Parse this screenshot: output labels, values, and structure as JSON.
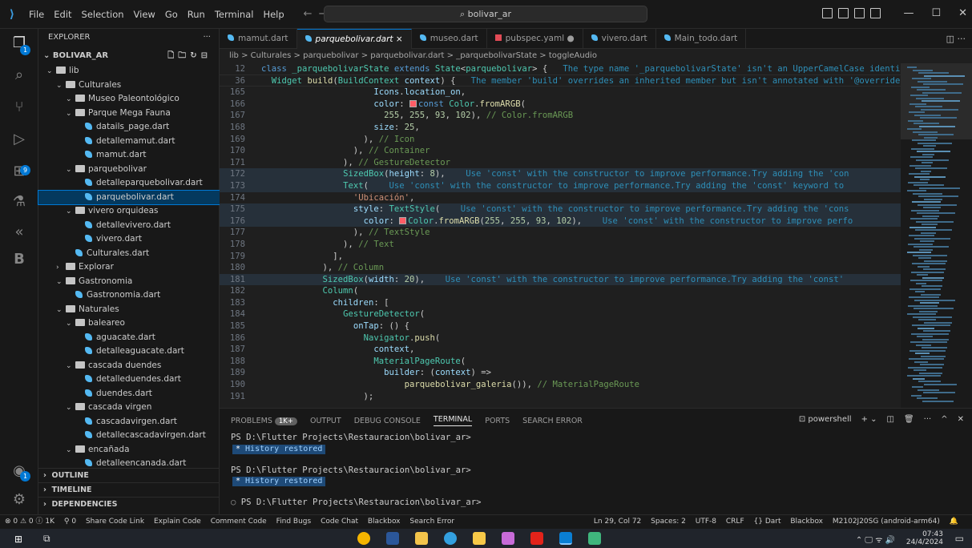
{
  "titlebar": {
    "menu": [
      "File",
      "Edit",
      "Selection",
      "View",
      "Go",
      "Run",
      "Terminal",
      "Help"
    ],
    "search": "bolivar_ar"
  },
  "sidebar": {
    "title": "EXPLORER",
    "root": "BOLIVAR_AR",
    "tree": [
      {
        "d": 0,
        "type": "folder",
        "open": true,
        "label": "lib"
      },
      {
        "d": 1,
        "type": "folder",
        "open": true,
        "label": "Culturales"
      },
      {
        "d": 2,
        "type": "folder",
        "open": true,
        "label": "Museo Paleontológico"
      },
      {
        "d": 2,
        "type": "folder",
        "open": true,
        "label": "Parque Mega Fauna"
      },
      {
        "d": 3,
        "type": "file",
        "label": "datails_page.dart"
      },
      {
        "d": 3,
        "type": "file",
        "label": "detallemamut.dart"
      },
      {
        "d": 3,
        "type": "file",
        "label": "mamut.dart"
      },
      {
        "d": 2,
        "type": "folder",
        "open": true,
        "label": "parquebolivar"
      },
      {
        "d": 3,
        "type": "file",
        "label": "detalleparquebolivar.dart"
      },
      {
        "d": 3,
        "type": "file",
        "label": "parquebolivar.dart",
        "selected": true
      },
      {
        "d": 2,
        "type": "folder",
        "open": true,
        "label": "vivero orquideas"
      },
      {
        "d": 3,
        "type": "file",
        "label": "detallevivero.dart"
      },
      {
        "d": 3,
        "type": "file",
        "label": "vivero.dart"
      },
      {
        "d": 2,
        "type": "file",
        "label": "Culturales.dart"
      },
      {
        "d": 1,
        "type": "folder",
        "open": false,
        "label": "Explorar"
      },
      {
        "d": 1,
        "type": "folder",
        "open": true,
        "label": "Gastronomia"
      },
      {
        "d": 2,
        "type": "file",
        "label": "Gastronomia.dart"
      },
      {
        "d": 1,
        "type": "folder",
        "open": true,
        "label": "Naturales"
      },
      {
        "d": 2,
        "type": "folder",
        "open": true,
        "label": "baleareo"
      },
      {
        "d": 3,
        "type": "file",
        "label": "aguacate.dart"
      },
      {
        "d": 3,
        "type": "file",
        "label": "detalleaguacate.dart"
      },
      {
        "d": 2,
        "type": "folder",
        "open": true,
        "label": "cascada duendes"
      },
      {
        "d": 3,
        "type": "file",
        "label": "detalleduendes.dart"
      },
      {
        "d": 3,
        "type": "file",
        "label": "duendes.dart"
      },
      {
        "d": 2,
        "type": "folder",
        "open": true,
        "label": "cascada virgen"
      },
      {
        "d": 3,
        "type": "file",
        "label": "cascadavirgen.dart"
      },
      {
        "d": 3,
        "type": "file",
        "label": "detallecascadavirgen.dart"
      },
      {
        "d": 2,
        "type": "folder",
        "open": true,
        "label": "encañada"
      },
      {
        "d": 3,
        "type": "file",
        "label": "detalleencanada.dart"
      }
    ],
    "bottom": [
      "OUTLINE",
      "TIMELINE",
      "DEPENDENCIES"
    ]
  },
  "tabs": [
    {
      "label": "mamut.dart",
      "kind": "dart"
    },
    {
      "label": "parquebolivar.dart",
      "kind": "dart",
      "active": true,
      "close": "×"
    },
    {
      "label": "museo.dart",
      "kind": "dart"
    },
    {
      "label": "pubspec.yaml",
      "kind": "yaml",
      "dirty": "●"
    },
    {
      "label": "vivero.dart",
      "kind": "dart"
    },
    {
      "label": "Main_todo.dart",
      "kind": "dart"
    }
  ],
  "breadcrumb": "lib > Culturales > parquebolivar > parquebolivar.dart > _parquebolivarState > toggleAudio",
  "editor": {
    "sticky": [
      {
        "n": "12",
        "html": "<span class='kw'>class</span> <span class='ty'>_parquebolivarState</span> <span class='kw'>extends</span> <span class='ty'>State</span>&lt;<span class='ty'>parquebolivar</span>&gt; {   <span class='hint'>The type name '_parquebolivarState' isn't an UpperCamelCase identifier.</span>"
      },
      {
        "n": "36",
        "html": "  <span class='ty'>Widget</span> <span class='fn'>build</span>(<span class='ty'>BuildContext</span> <span class='pl'>context</span>) {   <span class='hint'>The member 'build' overrides an inherited member but isn't annotated with '@override'.</span>"
      }
    ],
    "lines": [
      {
        "n": "165",
        "html": "                      <span class='pl'>Icons</span>.<span class='pl'>location_on</span>,"
      },
      {
        "n": "166",
        "html": "                      <span class='pl'>color</span>: <span class='sw'></span><span class='kw'>const</span> <span class='ty'>Color</span>.<span class='fn'>fromARGB</span>("
      },
      {
        "n": "167",
        "html": "                        <span class='num'>255</span>, <span class='num'>255</span>, <span class='num'>93</span>, <span class='num'>102</span>), <span class='cm'>// Color.fromARGB</span>"
      },
      {
        "n": "168",
        "html": "                      <span class='pl'>size</span>: <span class='num'>25</span>,"
      },
      {
        "n": "169",
        "html": "                    ), <span class='cm'>// Icon</span>"
      },
      {
        "n": "170",
        "html": "                  ), <span class='cm'>// Container</span>"
      },
      {
        "n": "171",
        "html": "                ), <span class='cm'>// GestureDetector</span>"
      },
      {
        "n": "172",
        "html": "                <span class='ty'>SizedBox</span>(<span class='pl'>height</span>: <span class='num'>8</span>),    <span class='hint'>Use 'const' with the constructor to improve performance.</span><span class='hint'>Try adding the 'con</span>",
        "hl": true
      },
      {
        "n": "173",
        "html": "                <span class='ty'>Text</span>(    <span class='hint'>Use 'const' with the constructor to improve performance.</span><span class='hint'>Try adding the 'const' keyword to</span>",
        "hl": true
      },
      {
        "n": "174",
        "html": "                  <span class='str'>'Ubicación'</span>,"
      },
      {
        "n": "175",
        "html": "                  <span class='pl'>style</span>: <span class='ty'>TextStyle</span>(    <span class='hint'>Use 'const' with the constructor to improve performance.</span><span class='hint'>Try adding the 'cons</span>",
        "hl": true
      },
      {
        "n": "176",
        "html": "                    <span class='pl'>color</span>: <span class='sw'></span><span class='ty'>Color</span>.<span class='fn'>fromARGB</span>(<span class='num'>255</span>, <span class='num'>255</span>, <span class='num'>93</span>, <span class='num'>102</span>),    <span class='hint'>Use 'const' with the constructor to improve perfo</span>",
        "hl": true
      },
      {
        "n": "177",
        "html": "                  ), <span class='cm'>// TextStyle</span>"
      },
      {
        "n": "178",
        "html": "                ), <span class='cm'>// Text</span>"
      },
      {
        "n": "179",
        "html": "              ],"
      },
      {
        "n": "180",
        "html": "            ), <span class='cm'>// Column</span>"
      },
      {
        "n": "181",
        "html": "            <span class='ty'>SizedBox</span>(<span class='pl'>width</span>: <span class='num'>20</span>),    <span class='hint'>Use 'const' with the constructor to improve performance.</span><span class='hint'>Try adding the 'const'</span>",
        "hl": true
      },
      {
        "n": "182",
        "html": "            <span class='ty'>Column</span>("
      },
      {
        "n": "183",
        "html": "              <span class='pl'>children</span>: ["
      },
      {
        "n": "184",
        "html": "                <span class='ty'>GestureDetector</span>("
      },
      {
        "n": "185",
        "html": "                  <span class='pl'>onTap</span>: () {"
      },
      {
        "n": "186",
        "html": "                    <span class='ty'>Navigator</span>.<span class='fn'>push</span>("
      },
      {
        "n": "187",
        "html": "                      <span class='pl'>context</span>,"
      },
      {
        "n": "188",
        "html": "                      <span class='ty'>MaterialPageRoute</span>("
      },
      {
        "n": "189",
        "html": "                        <span class='pl'>builder</span>: (<span class='pl'>context</span>) =&gt;"
      },
      {
        "n": "190",
        "html": "                            <span class='fn'>parquebolivar_galeria</span>()), <span class='cm'>// MaterialPageRoute</span>"
      },
      {
        "n": "191",
        "html": "                    );"
      }
    ]
  },
  "panel": {
    "tabs": [
      "PROBLEMS",
      "OUTPUT",
      "DEBUG CONSOLE",
      "TERMINAL",
      "PORTS",
      "SEARCH ERROR"
    ],
    "problems_badge": "1K+",
    "shell": "powershell",
    "prompt": "PS D:\\Flutter Projects\\Restauracion\\bolivar_ar>",
    "history": "History restored"
  },
  "statusbar": {
    "left": [
      "⊗ 0 ⚠ 0 ⓘ 1K",
      "⚲ 0",
      "Share Code Link",
      "Explain Code",
      "Comment Code",
      "Find Bugs",
      "Code Chat",
      "Blackbox",
      "Search Error"
    ],
    "right": [
      "Ln 29, Col 72",
      "Spaces: 2",
      "UTF-8",
      "CRLF",
      "{} Dart",
      "Blackbox",
      "M2102J20SG (android-arm64)"
    ]
  },
  "taskbar": {
    "time": "07:43",
    "date": "24/4/2024"
  }
}
